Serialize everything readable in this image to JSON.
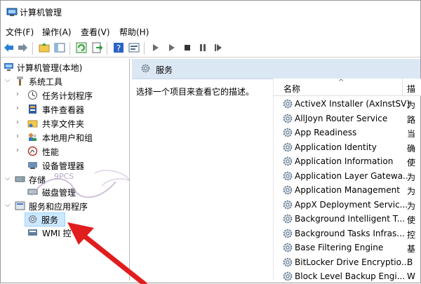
{
  "window": {
    "title": "计算机管理"
  },
  "menu": [
    {
      "label": "文件(F)"
    },
    {
      "label": "操作(A)"
    },
    {
      "label": "查看(V)"
    },
    {
      "label": "帮助(H)"
    }
  ],
  "tree": {
    "root": "计算机管理(本地)",
    "system_tools": "系统工具",
    "items": [
      {
        "label": "任务计划程序",
        "icon": "clock-icon"
      },
      {
        "label": "事件查看器",
        "icon": "event-viewer-icon"
      },
      {
        "label": "共享文件夹",
        "icon": "shared-folder-icon"
      },
      {
        "label": "本地用户和组",
        "icon": "users-icon"
      },
      {
        "label": "性能",
        "icon": "performance-icon"
      },
      {
        "label": "设备管理器",
        "icon": "device-manager-icon"
      }
    ],
    "storage": "存储",
    "disk_management": "磁盘管理",
    "services_apps": "服务和应用程序",
    "services": "服务",
    "wmi": "WMI 控"
  },
  "right": {
    "header": "服务",
    "description": "选择一个项目来查看它的描述。",
    "column_name": "名称",
    "column_desc": "描",
    "services": [
      {
        "name": "ActiveX Installer (AxInstSV)",
        "desc": "为"
      },
      {
        "name": "AllJoyn Router Service",
        "desc": "路"
      },
      {
        "name": "App Readiness",
        "desc": "当"
      },
      {
        "name": "Application Identity",
        "desc": "确"
      },
      {
        "name": "Application Information",
        "desc": "使"
      },
      {
        "name": "Application Layer Gatewa...",
        "desc": "为"
      },
      {
        "name": "Application Management",
        "desc": "为"
      },
      {
        "name": "AppX Deployment Servic...",
        "desc": "为"
      },
      {
        "name": "Background Intelligent T...",
        "desc": "使"
      },
      {
        "name": "Background Tasks Infras...",
        "desc": "控"
      },
      {
        "name": "Base Filtering Engine",
        "desc": "基"
      },
      {
        "name": "BitLocker Drive Encryptio...",
        "desc": "B"
      },
      {
        "name": "Block Level Backup Engi...",
        "desc": "W"
      }
    ]
  },
  "watermark": {
    "text": "9PCS"
  },
  "colors": {
    "accent": "#e11d1d",
    "header_bg": "#dce7f4",
    "selection": "#cce8ff"
  }
}
